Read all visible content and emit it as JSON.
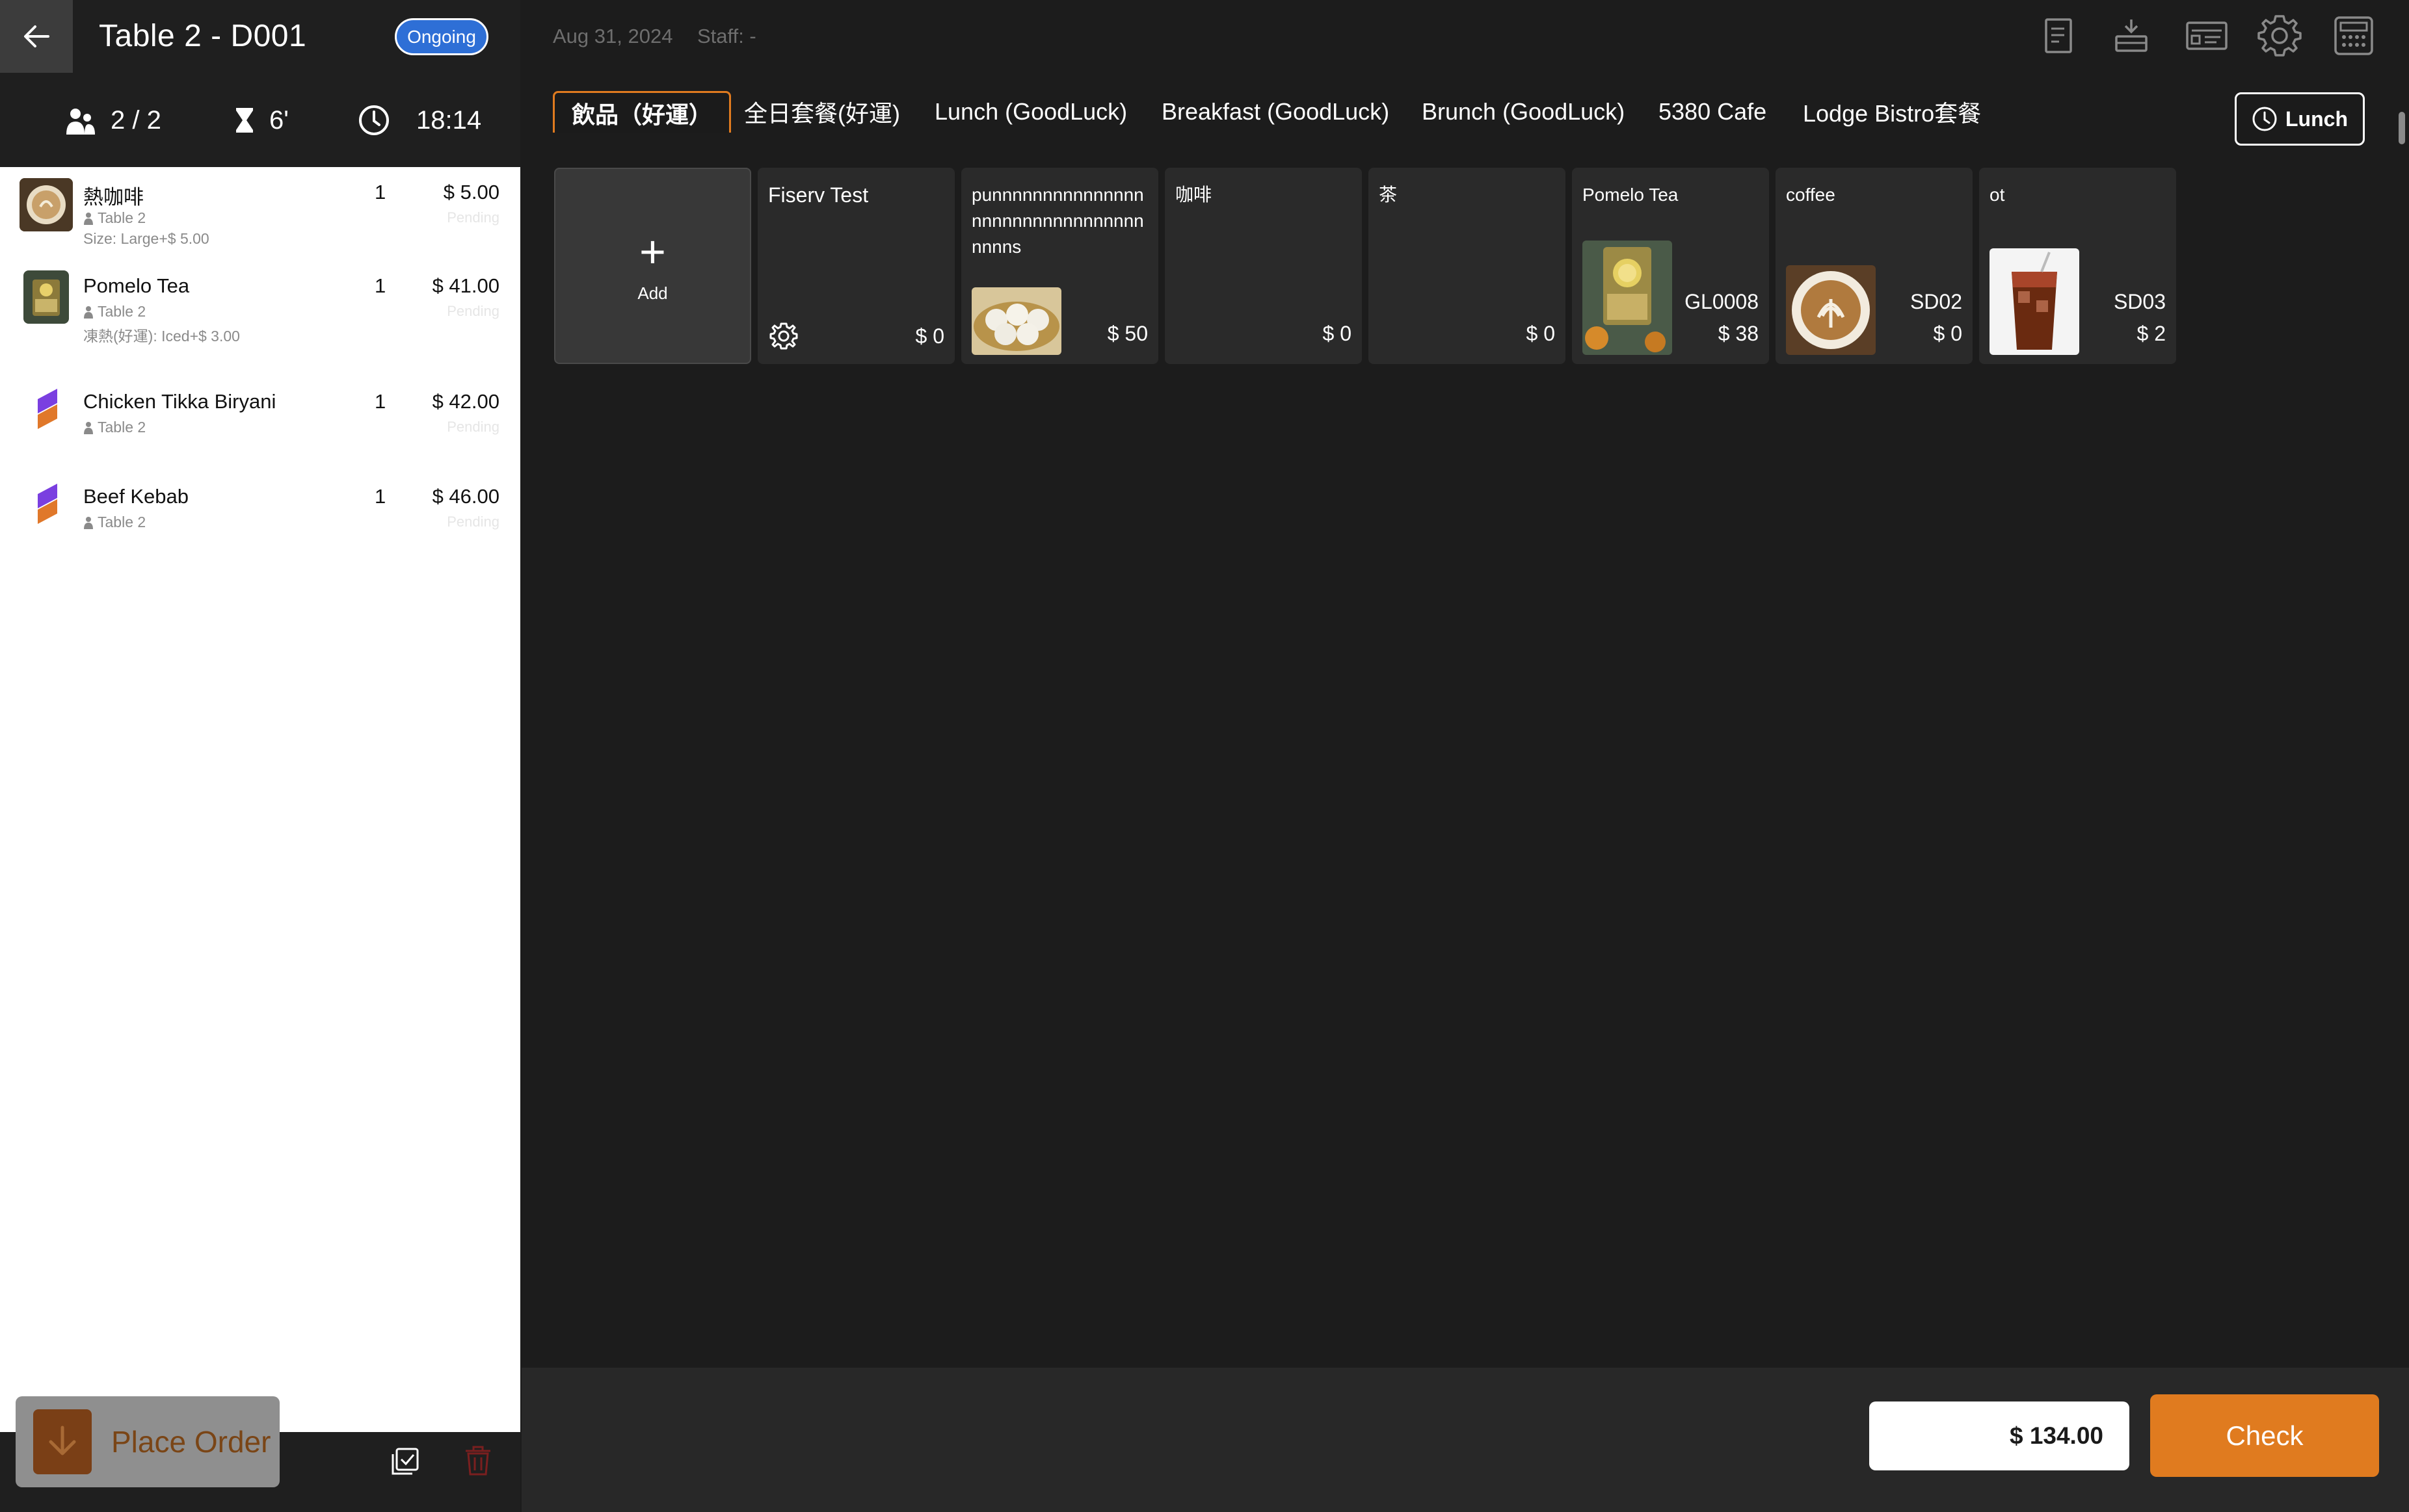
{
  "header": {
    "title": "Table 2 -  D001",
    "status": "Ongoing",
    "guests": "2 / 2",
    "duration": "6'",
    "time": "18:14"
  },
  "order_items": [
    {
      "name": "熱咖啡",
      "qty": "1",
      "price": "$ 5.00",
      "table": "Table 2",
      "option": "Size: Large+$ 5.00",
      "status": "Pending",
      "icon": "coffee-thumbnail"
    },
    {
      "name": "Pomelo Tea",
      "qty": "1",
      "price": "$ 41.00",
      "table": "Table 2",
      "option": "凍熱(好運): Iced+$ 3.00",
      "status": "Pending",
      "icon": "tea-thumbnail"
    },
    {
      "name": "Chicken Tikka Biryani",
      "qty": "1",
      "price": "$ 42.00",
      "table": "Table 2",
      "option": "",
      "status": "Pending",
      "icon": "brand-logo-icon"
    },
    {
      "name": "Beef Kebab",
      "qty": "1",
      "price": "$ 46.00",
      "table": "Table 2",
      "option": "",
      "status": "Pending",
      "icon": "brand-logo-icon"
    }
  ],
  "footer": {
    "place_order": "Place Order"
  },
  "topbar": {
    "date": "Aug 31, 2024",
    "staff": "Staff: -"
  },
  "tabs": [
    {
      "label": "飲品（好運）",
      "active": true
    },
    {
      "label": "全日套餐(好運)",
      "active": false
    },
    {
      "label": "Lunch (GoodLuck)",
      "active": false
    },
    {
      "label": "Breakfast (GoodLuck)",
      "active": false
    },
    {
      "label": "Brunch (GoodLuck)",
      "active": false
    },
    {
      "label": "5380 Cafe",
      "active": false
    },
    {
      "label": "Lodge Bistro套餐",
      "active": false
    }
  ],
  "menu_selector": "Lunch",
  "tiles": {
    "add_label": "Add",
    "items": [
      {
        "name": "Fiserv Test",
        "code": "",
        "price": "$ 0"
      },
      {
        "name": "punnnnnnnnnnnnnnnnnnnnnnnnnnnnnnnnnnnns",
        "code": "",
        "price": "$ 50"
      },
      {
        "name": "咖啡",
        "code": "",
        "price": "$ 0"
      },
      {
        "name": "茶",
        "code": "",
        "price": "$ 0"
      },
      {
        "name": "Pomelo Tea",
        "code": "GL0008",
        "price": "$ 38"
      },
      {
        "name": "coffee",
        "code": "SD02",
        "price": "$ 0"
      },
      {
        "name": "ot",
        "code": "SD03",
        "price": "$ 2"
      }
    ]
  },
  "total": "$ 134.00",
  "check_label": "Check",
  "colors": {
    "accent": "#e07b1f",
    "status_blue": "#2e6fd6",
    "panel_dark": "#1c1c1c"
  }
}
